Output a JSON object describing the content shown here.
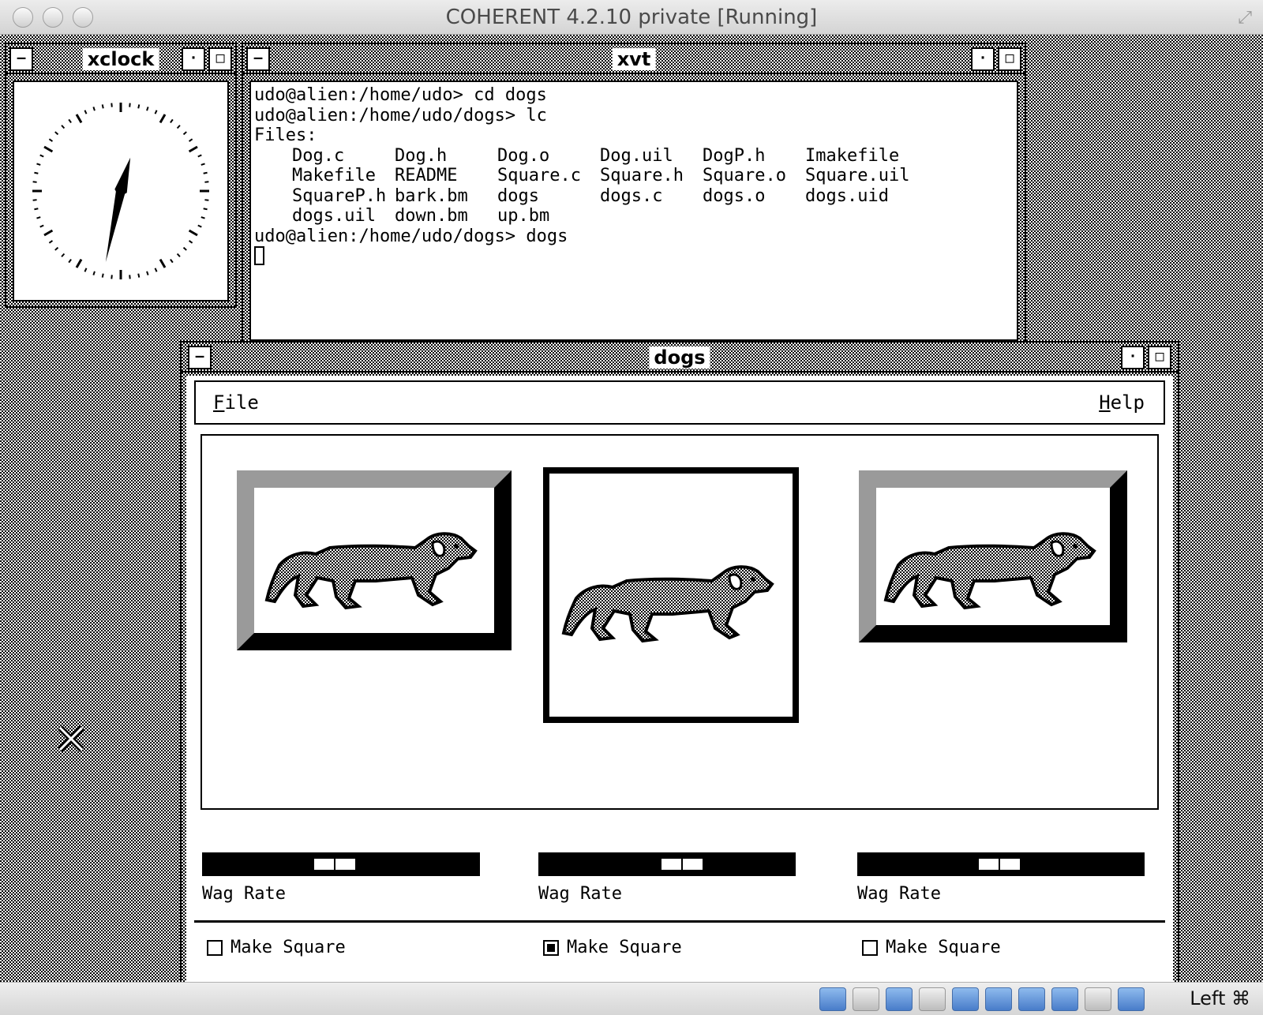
{
  "host": {
    "title": "COHERENT 4.2.10 private [Running]",
    "host_key": "Left ⌘",
    "status_icons": [
      "hard-disk-icon",
      "floppy-icon",
      "optical-drive-icon",
      "usb-icon",
      "shared-folder-icon",
      "display-icon",
      "network-icon",
      "cpu-icon",
      "mouse-integration-icon",
      "capture-icon"
    ]
  },
  "xclock": {
    "title": "xclock",
    "time": "12:32"
  },
  "xvt": {
    "title": "xvt",
    "lines": [
      "udo@alien:/home/udo> cd dogs",
      "udo@alien:/home/udo/dogs> lc",
      "Files:"
    ],
    "files": [
      "Dog.c",
      "Dog.h",
      "Dog.o",
      "Dog.uil",
      "DogP.h",
      "Imakefile",
      "Makefile",
      "README",
      "Square.c",
      "Square.h",
      "Square.o",
      "Square.uil",
      "SquareP.h",
      "bark.bm",
      "dogs",
      "dogs.c",
      "dogs.o",
      "dogs.uid",
      "dogs.uil",
      "down.bm",
      "up.bm"
    ],
    "last_line": "udo@alien:/home/udo/dogs> dogs"
  },
  "dogs": {
    "title": "dogs",
    "menu": {
      "file": "File",
      "help": "Help",
      "file_mnemonic": "F",
      "file_rest": "ile",
      "help_pre": "H",
      "help_rest": "elp"
    },
    "panels": [
      {
        "wag_label": "Wag Rate",
        "wag_value": 0.48,
        "check_label": "Make Square",
        "checked": false,
        "style": "raised"
      },
      {
        "wag_label": "Wag Rate",
        "wag_value": 0.58,
        "check_label": "Make Square",
        "checked": true,
        "style": "sunken"
      },
      {
        "wag_label": "Wag Rate",
        "wag_value": 0.5,
        "check_label": "Make Square",
        "checked": false,
        "style": "raised"
      }
    ]
  }
}
